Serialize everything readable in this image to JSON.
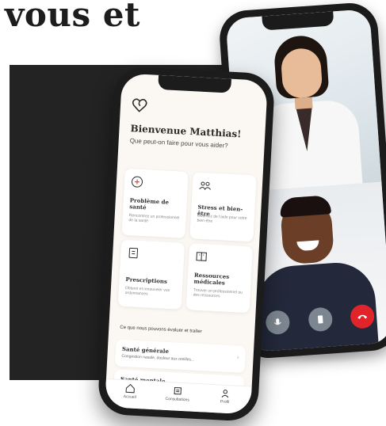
{
  "headline": "vous et",
  "app": {
    "welcome_title": "Bienvenue Matthias!",
    "welcome_subtitle": "Que peut-on faire pour vous aider?",
    "cards": [
      {
        "title": "Problème de santé",
        "desc": "Rencontrez un professionnel de la santé",
        "icon": "plus-circle-icon"
      },
      {
        "title": "Stress et bien-être",
        "desc": "Obtenez de l'aide pour votre bien-être",
        "icon": "people-icon"
      },
      {
        "title": "Prescriptions",
        "desc": "Obtenir et renouveler vos ordonnances",
        "icon": "prescription-icon"
      },
      {
        "title": "Ressources médicales",
        "desc": "Trouver un professionnel ou des ressources",
        "icon": "book-icon"
      }
    ],
    "section_title": "Ce que nous pouvons évaluer et traiter",
    "list": [
      {
        "title": "Santé générale",
        "subtitle": "Congestion nasale, douleur aux oreilles..."
      },
      {
        "title": "Santé mentale",
        "subtitle": ""
      }
    ],
    "tabs": [
      {
        "label": "Accueil",
        "icon": "home-icon"
      },
      {
        "label": "Consultations",
        "icon": "list-icon"
      },
      {
        "label": "Profil",
        "icon": "person-icon"
      }
    ]
  },
  "call": {
    "buttons": [
      "mute-icon",
      "phone-device-icon",
      "end-call-icon"
    ],
    "end_color": "#e0242a"
  }
}
